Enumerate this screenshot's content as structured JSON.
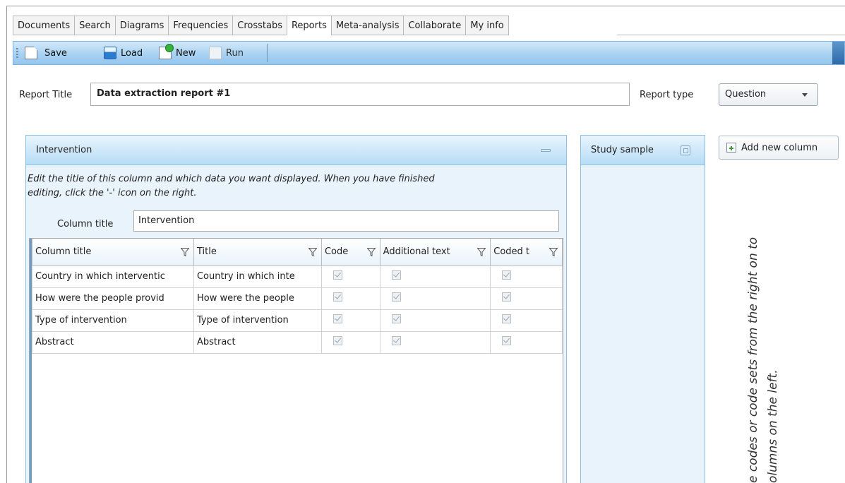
{
  "tabs": [
    "Documents",
    "Search",
    "Diagrams",
    "Frequencies",
    "Crosstabs",
    "Reports",
    "Meta-analysis",
    "Collaborate",
    "My info"
  ],
  "active_tab": "Reports",
  "toolbar": {
    "save": "Save",
    "load": "Load",
    "new": "New",
    "run": "Run"
  },
  "report": {
    "title_label": "Report Title",
    "title_value": "Data extraction report #1",
    "type_label": "Report type",
    "type_value": "Question"
  },
  "intervention_panel": {
    "header": "Intervention",
    "hint": "Edit the title of this column and which data you want displayed. When you have finished editing, click the '-' icon on the right.",
    "hint_line1": "Edit the title of this column and which data you want displayed. When you have finished",
    "hint_line2": "editing, click the '-' icon on the right.",
    "column_title_label": "Column title",
    "column_title_value": "Intervention",
    "grid": {
      "headers": [
        "Column title",
        "Title",
        "Code",
        "Additional text",
        "Coded t"
      ],
      "rows": [
        {
          "column_title": "Country in which interventic",
          "title": "Country in which inte",
          "code": true,
          "additional_text": true,
          "coded_text": true
        },
        {
          "column_title": "How were the people provid",
          "title": "How were the people",
          "code": true,
          "additional_text": true,
          "coded_text": true
        },
        {
          "column_title": "Type of intervention",
          "title": "Type of intervention",
          "code": true,
          "additional_text": true,
          "coded_text": true
        },
        {
          "column_title": "Abstract",
          "title": "Abstract",
          "code": true,
          "additional_text": true,
          "coded_text": true
        }
      ]
    }
  },
  "study_sample": {
    "header": "Study sample"
  },
  "add_column": {
    "label": "Add new column"
  },
  "side_instruction": {
    "line1": "e codes or code sets from the right on to",
    "line2": "olumns on the left."
  },
  "colors": {
    "panel_header": "#b7dcf5",
    "toolbar": "#a9d2f1",
    "panel_bg": "#e8f3fb"
  }
}
